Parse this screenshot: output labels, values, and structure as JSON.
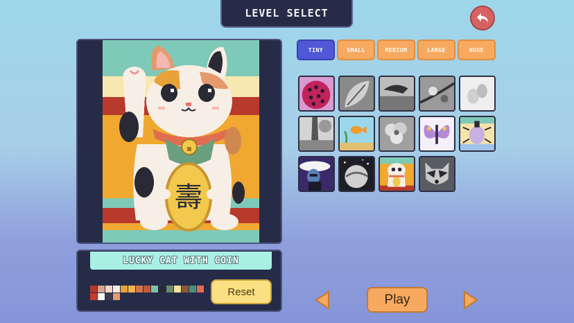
{
  "header": {
    "title": "LEVEL SELECT"
  },
  "size_tabs": [
    {
      "label": "TINY",
      "active": true
    },
    {
      "label": "SMALL",
      "active": false
    },
    {
      "label": "MEDIUM",
      "active": false
    },
    {
      "label": "LARGE",
      "active": false
    },
    {
      "label": "HUGE",
      "active": false
    }
  ],
  "levels": [
    {
      "name": "strawberry",
      "colored": true
    },
    {
      "name": "leaf",
      "colored": false
    },
    {
      "name": "bird",
      "colored": false
    },
    {
      "name": "flower-branch",
      "colored": false
    },
    {
      "name": "pears",
      "colored": false
    },
    {
      "name": "tree-rocks",
      "colored": false
    },
    {
      "name": "goldfish-bowl",
      "colored": true
    },
    {
      "name": "hibiscus",
      "colored": false
    },
    {
      "name": "butterfly",
      "colored": true
    },
    {
      "name": "beetle",
      "colored": true
    },
    {
      "name": "lady-with-hat",
      "colored": true
    },
    {
      "name": "moon-night",
      "colored": true
    },
    {
      "name": "lucky-cat",
      "colored": true
    },
    {
      "name": "raccoon",
      "colored": true
    }
  ],
  "selected": {
    "name": "LUCKY CAT WITH COIN",
    "coin_glyph": "壽",
    "palette": [
      "#b03a2e",
      "#d9a38f",
      "#f2d7c6",
      "#f5f0e6",
      "#e8a23a",
      "#f2b64c",
      "#d8744a",
      "#c25a38",
      "#7fbfa8",
      "#2a2a35",
      "#6a8f6f",
      "#f7e29a",
      "#8a5a3a",
      "#4a8f80",
      "#e06d4f",
      "#c93a2a",
      "#ffffff",
      "#3a3a4a",
      "#e59a6e"
    ]
  },
  "buttons": {
    "reset": "Reset",
    "play": "Play"
  },
  "icons": {
    "back": "back-arrow-icon",
    "prev": "triangle-left-icon",
    "next": "triangle-right-icon"
  },
  "colors": {
    "accent": "#5058d8",
    "tab": "#f6a95f",
    "panel": "#262b48",
    "reset": "#fbe083"
  }
}
